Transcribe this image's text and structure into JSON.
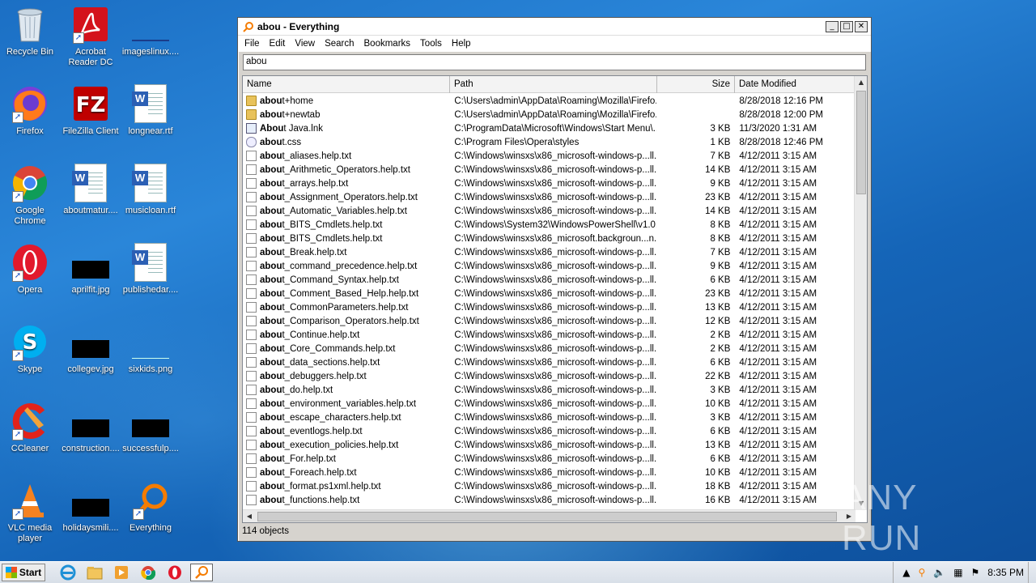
{
  "desktop": {
    "icons": [
      {
        "label": "Recycle Bin",
        "icon": "recycle-bin-icon"
      },
      {
        "label": "Acrobat Reader DC",
        "icon": "acrobat-icon"
      },
      {
        "label": "imageslinux....",
        "icon": "image-file-icon"
      },
      {
        "label": "Firefox",
        "icon": "firefox-icon"
      },
      {
        "label": "FileZilla Client",
        "icon": "filezilla-icon"
      },
      {
        "label": "longnear.rtf",
        "icon": "word-doc-icon"
      },
      {
        "label": "Google Chrome",
        "icon": "chrome-icon"
      },
      {
        "label": "aboutmatur....",
        "icon": "word-doc-icon"
      },
      {
        "label": "musicloan.rtf",
        "icon": "word-doc-icon"
      },
      {
        "label": "Opera",
        "icon": "opera-icon"
      },
      {
        "label": "aprilfit.jpg",
        "icon": "image-file-icon"
      },
      {
        "label": "publishedar....",
        "icon": "word-doc-icon"
      },
      {
        "label": "Skype",
        "icon": "skype-icon"
      },
      {
        "label": "collegev.jpg",
        "icon": "image-file-icon"
      },
      {
        "label": "sixkids.png",
        "icon": "image-file-icon"
      },
      {
        "label": "CCleaner",
        "icon": "ccleaner-icon"
      },
      {
        "label": "construction....",
        "icon": "image-file-icon"
      },
      {
        "label": "successfulp....",
        "icon": "image-file-icon"
      },
      {
        "label": "VLC media player",
        "icon": "vlc-icon"
      },
      {
        "label": "holidaysmili....",
        "icon": "image-file-icon"
      },
      {
        "label": "Everything",
        "icon": "everything-icon"
      }
    ]
  },
  "window": {
    "title": "abou - Everything",
    "menu": [
      "File",
      "Edit",
      "View",
      "Search",
      "Bookmarks",
      "Tools",
      "Help"
    ],
    "search_value": "abou",
    "columns": [
      "Name",
      "Path",
      "Size",
      "Date Modified"
    ],
    "rows": [
      {
        "bold": "abou",
        "rest": "t+home",
        "path": "C:\\Users\\admin\\AppData\\Roaming\\Mozilla\\Firefo...",
        "size": "",
        "date": "8/28/2018 12:16 PM",
        "type": "folder"
      },
      {
        "bold": "abou",
        "rest": "t+newtab",
        "path": "C:\\Users\\admin\\AppData\\Roaming\\Mozilla\\Firefo...",
        "size": "",
        "date": "8/28/2018 12:00 PM",
        "type": "folder"
      },
      {
        "bold": "Abou",
        "rest": "t Java.lnk",
        "path": "C:\\ProgramData\\Microsoft\\Windows\\Start Menu\\...",
        "size": "3 KB",
        "date": "11/3/2020 1:31 AM",
        "type": "lnk"
      },
      {
        "bold": "abou",
        "rest": "t.css",
        "path": "C:\\Program Files\\Opera\\styles",
        "size": "1 KB",
        "date": "8/28/2018 12:46 PM",
        "type": "css"
      },
      {
        "bold": "abou",
        "rest": "t_aliases.help.txt",
        "path": "C:\\Windows\\winsxs\\x86_microsoft-windows-p...ll...",
        "size": "7 KB",
        "date": "4/12/2011 3:15 AM",
        "type": "file"
      },
      {
        "bold": "abou",
        "rest": "t_Arithmetic_Operators.help.txt",
        "path": "C:\\Windows\\winsxs\\x86_microsoft-windows-p...ll...",
        "size": "14 KB",
        "date": "4/12/2011 3:15 AM",
        "type": "file"
      },
      {
        "bold": "abou",
        "rest": "t_arrays.help.txt",
        "path": "C:\\Windows\\winsxs\\x86_microsoft-windows-p...ll...",
        "size": "9 KB",
        "date": "4/12/2011 3:15 AM",
        "type": "file"
      },
      {
        "bold": "abou",
        "rest": "t_Assignment_Operators.help.txt",
        "path": "C:\\Windows\\winsxs\\x86_microsoft-windows-p...ll...",
        "size": "23 KB",
        "date": "4/12/2011 3:15 AM",
        "type": "file"
      },
      {
        "bold": "abou",
        "rest": "t_Automatic_Variables.help.txt",
        "path": "C:\\Windows\\winsxs\\x86_microsoft-windows-p...ll...",
        "size": "14 KB",
        "date": "4/12/2011 3:15 AM",
        "type": "file"
      },
      {
        "bold": "abou",
        "rest": "t_BITS_Cmdlets.help.txt",
        "path": "C:\\Windows\\System32\\WindowsPowerShell\\v1.0...",
        "size": "8 KB",
        "date": "4/12/2011 3:15 AM",
        "type": "file"
      },
      {
        "bold": "abou",
        "rest": "t_BITS_Cmdlets.help.txt",
        "path": "C:\\Windows\\winsxs\\x86_microsoft.backgroun...n...",
        "size": "8 KB",
        "date": "4/12/2011 3:15 AM",
        "type": "file"
      },
      {
        "bold": "abou",
        "rest": "t_Break.help.txt",
        "path": "C:\\Windows\\winsxs\\x86_microsoft-windows-p...ll...",
        "size": "7 KB",
        "date": "4/12/2011 3:15 AM",
        "type": "file"
      },
      {
        "bold": "abou",
        "rest": "t_command_precedence.help.txt",
        "path": "C:\\Windows\\winsxs\\x86_microsoft-windows-p...ll...",
        "size": "9 KB",
        "date": "4/12/2011 3:15 AM",
        "type": "file"
      },
      {
        "bold": "abou",
        "rest": "t_Command_Syntax.help.txt",
        "path": "C:\\Windows\\winsxs\\x86_microsoft-windows-p...ll...",
        "size": "6 KB",
        "date": "4/12/2011 3:15 AM",
        "type": "file"
      },
      {
        "bold": "abou",
        "rest": "t_Comment_Based_Help.help.txt",
        "path": "C:\\Windows\\winsxs\\x86_microsoft-windows-p...ll...",
        "size": "23 KB",
        "date": "4/12/2011 3:15 AM",
        "type": "file"
      },
      {
        "bold": "abou",
        "rest": "t_CommonParameters.help.txt",
        "path": "C:\\Windows\\winsxs\\x86_microsoft-windows-p...ll...",
        "size": "13 KB",
        "date": "4/12/2011 3:15 AM",
        "type": "file"
      },
      {
        "bold": "abou",
        "rest": "t_Comparison_Operators.help.txt",
        "path": "C:\\Windows\\winsxs\\x86_microsoft-windows-p...ll...",
        "size": "12 KB",
        "date": "4/12/2011 3:15 AM",
        "type": "file"
      },
      {
        "bold": "abou",
        "rest": "t_Continue.help.txt",
        "path": "C:\\Windows\\winsxs\\x86_microsoft-windows-p...ll...",
        "size": "2 KB",
        "date": "4/12/2011 3:15 AM",
        "type": "file"
      },
      {
        "bold": "abou",
        "rest": "t_Core_Commands.help.txt",
        "path": "C:\\Windows\\winsxs\\x86_microsoft-windows-p...ll...",
        "size": "2 KB",
        "date": "4/12/2011 3:15 AM",
        "type": "file"
      },
      {
        "bold": "abou",
        "rest": "t_data_sections.help.txt",
        "path": "C:\\Windows\\winsxs\\x86_microsoft-windows-p...ll...",
        "size": "6 KB",
        "date": "4/12/2011 3:15 AM",
        "type": "file"
      },
      {
        "bold": "abou",
        "rest": "t_debuggers.help.txt",
        "path": "C:\\Windows\\winsxs\\x86_microsoft-windows-p...ll...",
        "size": "22 KB",
        "date": "4/12/2011 3:15 AM",
        "type": "file"
      },
      {
        "bold": "abou",
        "rest": "t_do.help.txt",
        "path": "C:\\Windows\\winsxs\\x86_microsoft-windows-p...ll...",
        "size": "3 KB",
        "date": "4/12/2011 3:15 AM",
        "type": "file"
      },
      {
        "bold": "abou",
        "rest": "t_environment_variables.help.txt",
        "path": "C:\\Windows\\winsxs\\x86_microsoft-windows-p...ll...",
        "size": "10 KB",
        "date": "4/12/2011 3:15 AM",
        "type": "file"
      },
      {
        "bold": "abou",
        "rest": "t_escape_characters.help.txt",
        "path": "C:\\Windows\\winsxs\\x86_microsoft-windows-p...ll...",
        "size": "3 KB",
        "date": "4/12/2011 3:15 AM",
        "type": "file"
      },
      {
        "bold": "abou",
        "rest": "t_eventlogs.help.txt",
        "path": "C:\\Windows\\winsxs\\x86_microsoft-windows-p...ll...",
        "size": "6 KB",
        "date": "4/12/2011 3:15 AM",
        "type": "file"
      },
      {
        "bold": "abou",
        "rest": "t_execution_policies.help.txt",
        "path": "C:\\Windows\\winsxs\\x86_microsoft-windows-p...ll...",
        "size": "13 KB",
        "date": "4/12/2011 3:15 AM",
        "type": "file"
      },
      {
        "bold": "abou",
        "rest": "t_For.help.txt",
        "path": "C:\\Windows\\winsxs\\x86_microsoft-windows-p...ll...",
        "size": "6 KB",
        "date": "4/12/2011 3:15 AM",
        "type": "file"
      },
      {
        "bold": "abou",
        "rest": "t_Foreach.help.txt",
        "path": "C:\\Windows\\winsxs\\x86_microsoft-windows-p...ll...",
        "size": "10 KB",
        "date": "4/12/2011 3:15 AM",
        "type": "file"
      },
      {
        "bold": "abou",
        "rest": "t_format.ps1xml.help.txt",
        "path": "C:\\Windows\\winsxs\\x86_microsoft-windows-p...ll...",
        "size": "18 KB",
        "date": "4/12/2011 3:15 AM",
        "type": "file"
      },
      {
        "bold": "abou",
        "rest": "t_functions.help.txt",
        "path": "C:\\Windows\\winsxs\\x86_microsoft-windows-p...ll...",
        "size": "16 KB",
        "date": "4/12/2011 3:15 AM",
        "type": "file"
      }
    ],
    "status": "114 objects"
  },
  "watermark": "ANY RUN",
  "taskbar": {
    "start_label": "Start",
    "apps": [
      "ie-icon",
      "explorer-icon",
      "media-player-icon",
      "chrome-icon",
      "opera-icon",
      "everything-icon"
    ],
    "tray_icons": [
      "show-hidden-icon",
      "everything-tray-icon",
      "volume-icon",
      "network-icon",
      "flag-icon"
    ],
    "clock": "8:35 PM"
  }
}
